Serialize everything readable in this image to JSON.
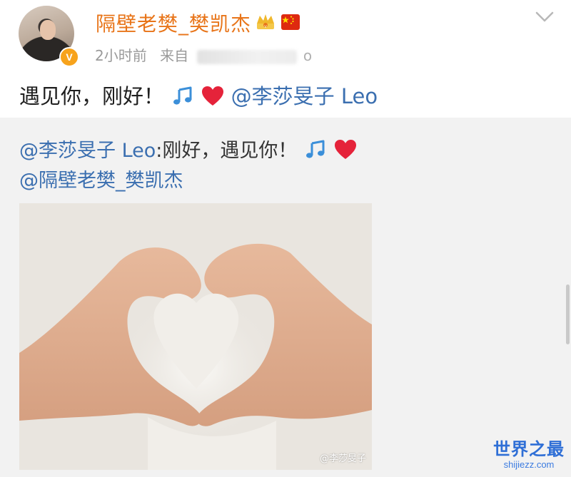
{
  "header": {
    "username": "隔壁老樊_樊凯杰",
    "time": "2小时前",
    "source_label": "来自",
    "source_tail": "o",
    "badge": "V"
  },
  "post": {
    "text": "遇见你，刚好！",
    "mention": "@李莎旻子 Leo"
  },
  "repost": {
    "author_mention": "@李莎旻子 Leo",
    "text": ":刚好，遇见你！",
    "mention2": "@隔壁老樊_樊凯杰"
  },
  "photo": {
    "watermark": "@李莎旻子"
  },
  "site": {
    "title": "世界之最",
    "url": "shijiezz.com"
  },
  "colors": {
    "username": "#e8751a",
    "mention": "#3b6fb0",
    "repost_bg": "#f2f2f2"
  },
  "icons": {
    "crown": "crown-icon",
    "flag": "china-flag-icon",
    "music": "music-note-icon",
    "heart": "red-heart-icon",
    "chevron": "chevron-down-icon"
  }
}
